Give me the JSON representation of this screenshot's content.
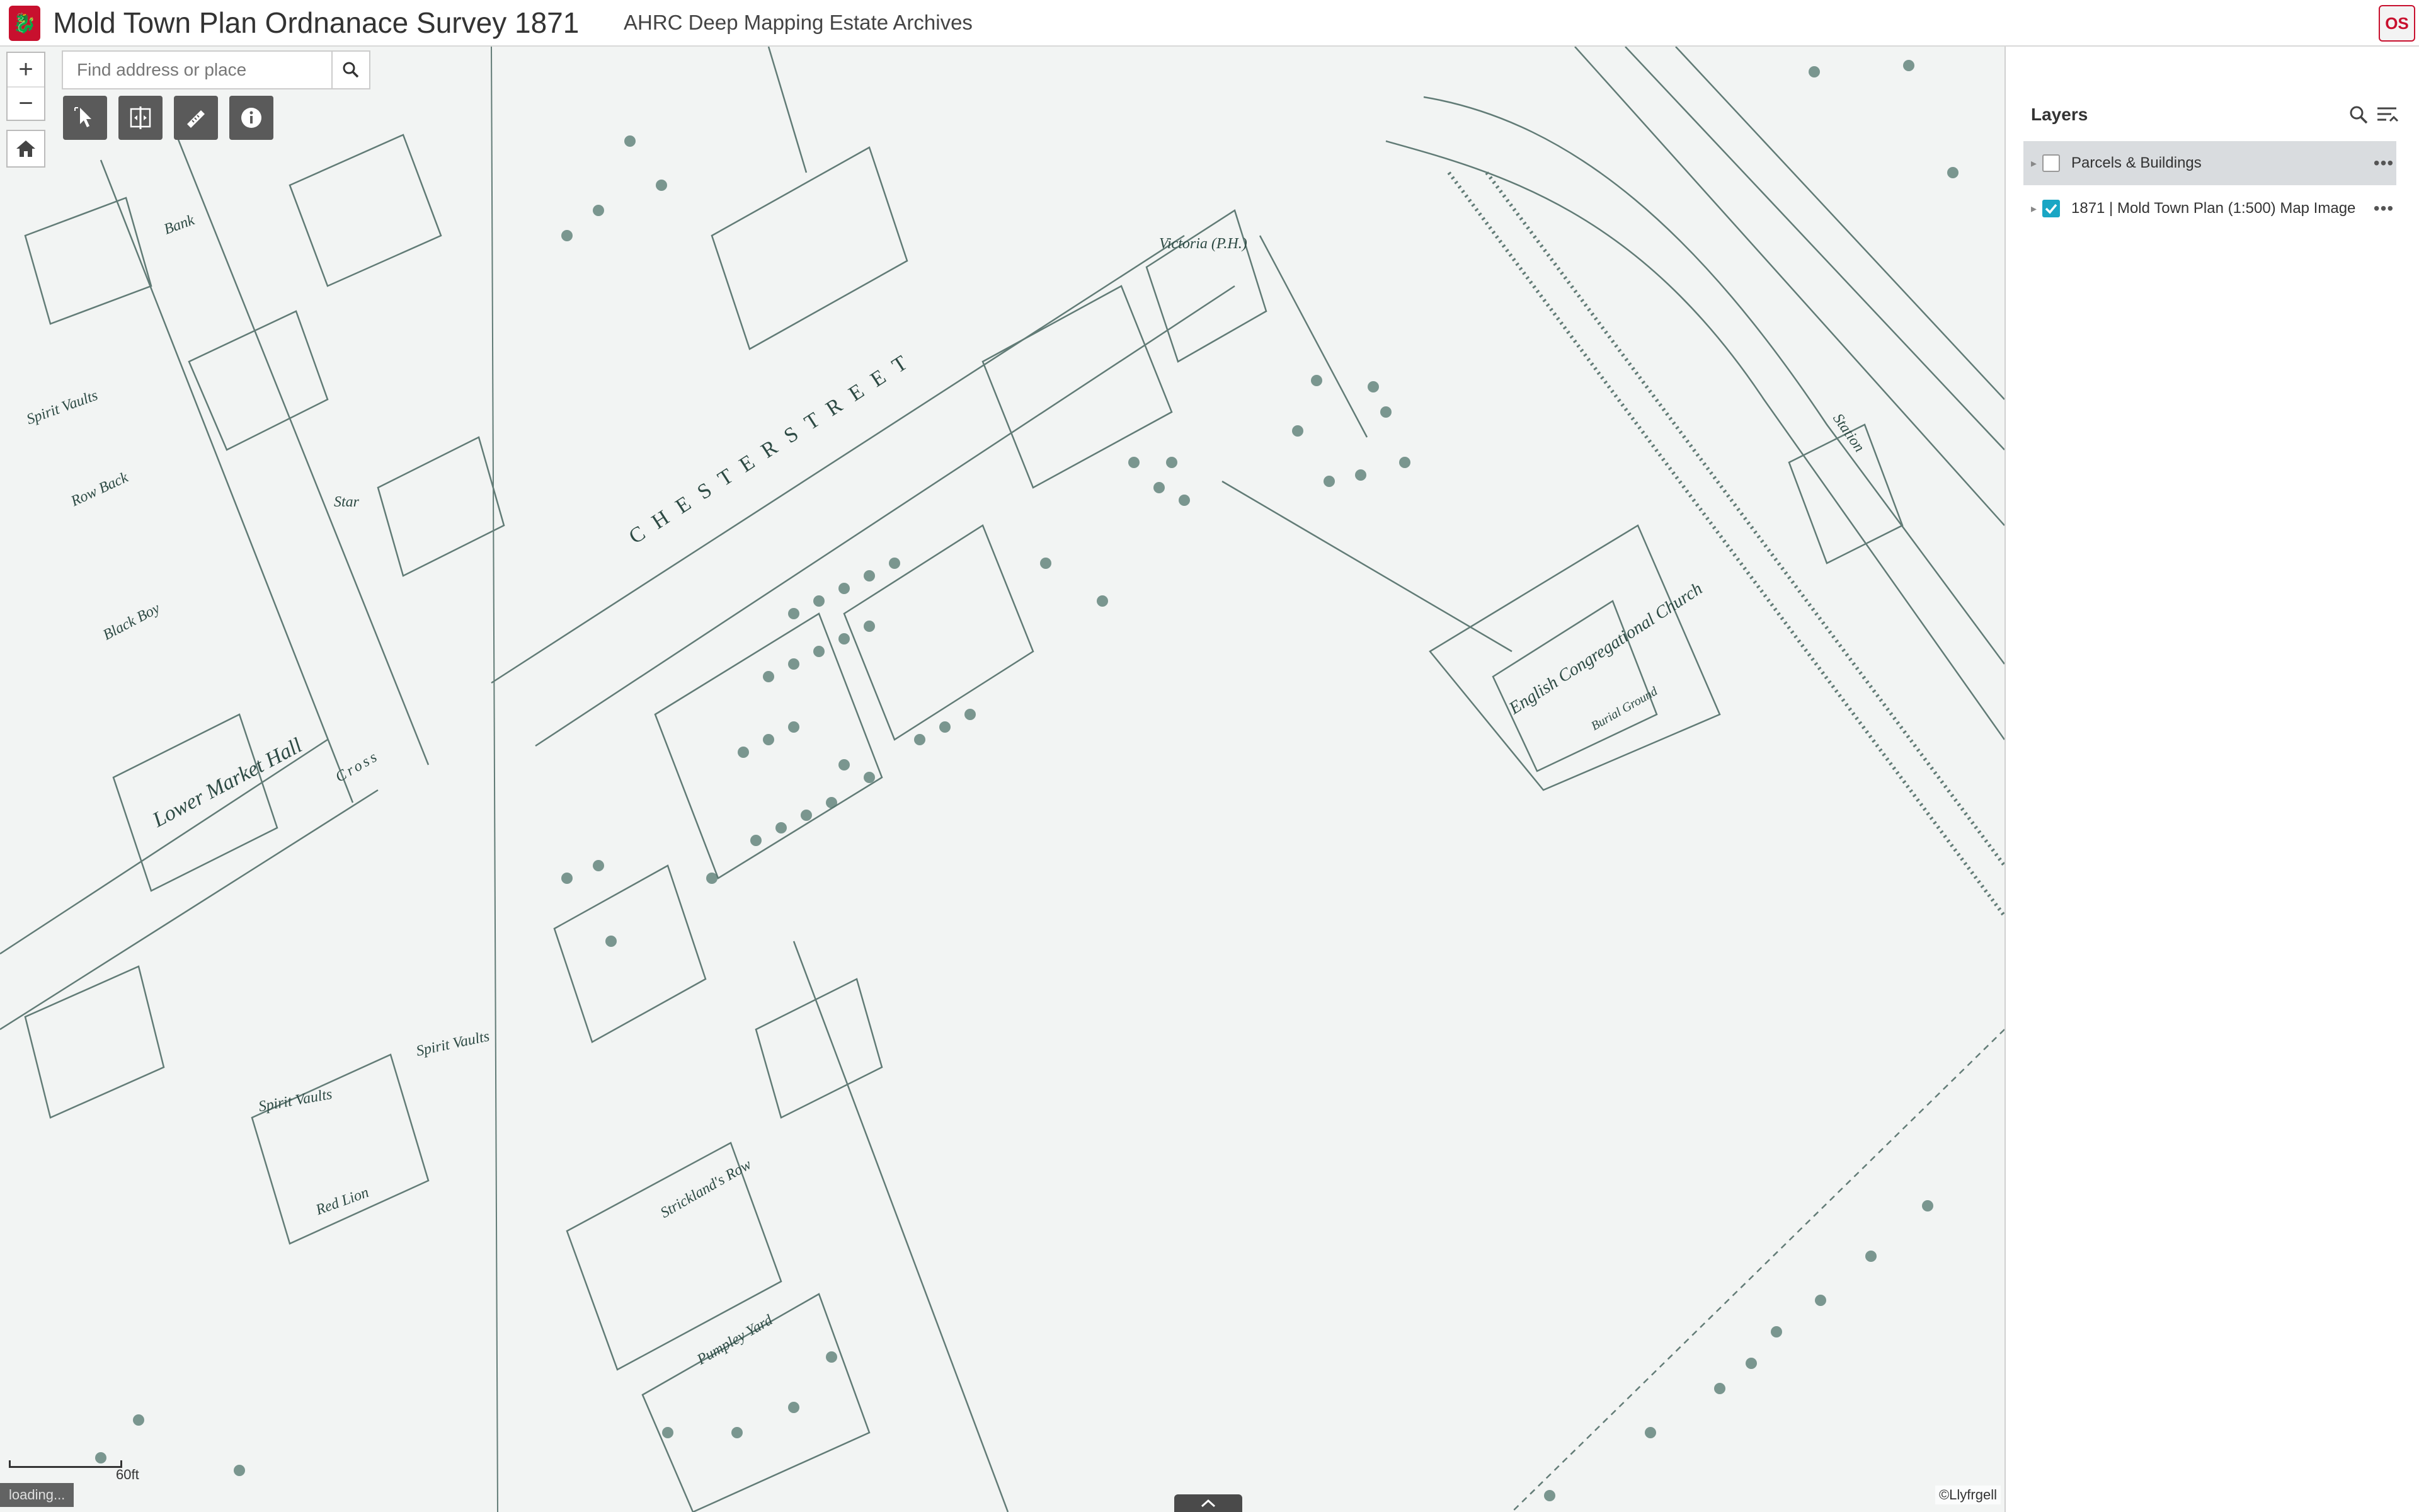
{
  "header": {
    "logo_glyph": "🐉",
    "title": "Mold Town Plan Ordnanace Survey 1871",
    "subtitle": "AHRC Deep Mapping Estate Archives",
    "user_initials": "OS"
  },
  "map": {
    "zoom_in": "+",
    "zoom_out": "−",
    "search": {
      "placeholder": "Find address or place"
    },
    "scale_label": "60ft",
    "loading_text": "loading...",
    "attribution": "©Llyfrgell",
    "labels": [
      {
        "text": "C H E S T E R   S T R E E T"
      },
      {
        "text": "English Congregational Church"
      },
      {
        "text": "Lower Market Hall"
      },
      {
        "text": "Spirit Vaults"
      },
      {
        "text": "Red Lion"
      },
      {
        "text": "Row Back"
      },
      {
        "text": "Black Boy"
      },
      {
        "text": "Star"
      },
      {
        "text": "Victoria (P.H.)"
      },
      {
        "text": "Station"
      },
      {
        "text": "Strickland's Row"
      },
      {
        "text": "Pumpley Yard"
      },
      {
        "text": "Spirit Vaults"
      },
      {
        "text": "Bank"
      },
      {
        "text": "Cross"
      },
      {
        "text": "Spirit Vaults"
      },
      {
        "text": "Burial Ground"
      }
    ]
  },
  "panel": {
    "title": "Layers",
    "layers": [
      {
        "label": "Parcels & Buildings",
        "checked": false,
        "more": "•••"
      },
      {
        "label": "1871 | Mold Town Plan (1:500) Map Image",
        "checked": true,
        "more": "•••"
      }
    ]
  },
  "colors": {
    "accent": "#1aa6c4",
    "brand": "#c8102e",
    "ink": "#2d4a44"
  }
}
